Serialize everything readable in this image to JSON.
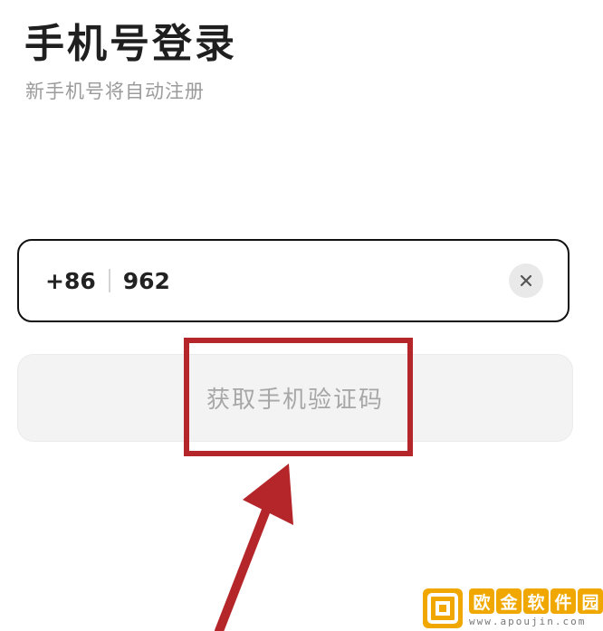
{
  "header": {
    "title": "手机号登录",
    "subtitle": "新手机号将自动注册"
  },
  "phone_input": {
    "country_code": "+86",
    "value": "962",
    "clear_icon": "close-icon"
  },
  "code_button": {
    "label": "获取手机验证码"
  },
  "annotation": {
    "highlight_color": "#b5262a"
  },
  "watermark": {
    "brand_chars": [
      "欧",
      "金",
      "软",
      "件",
      "园"
    ],
    "url": "www.apoujin.com",
    "accent_color": "#f0a800"
  }
}
